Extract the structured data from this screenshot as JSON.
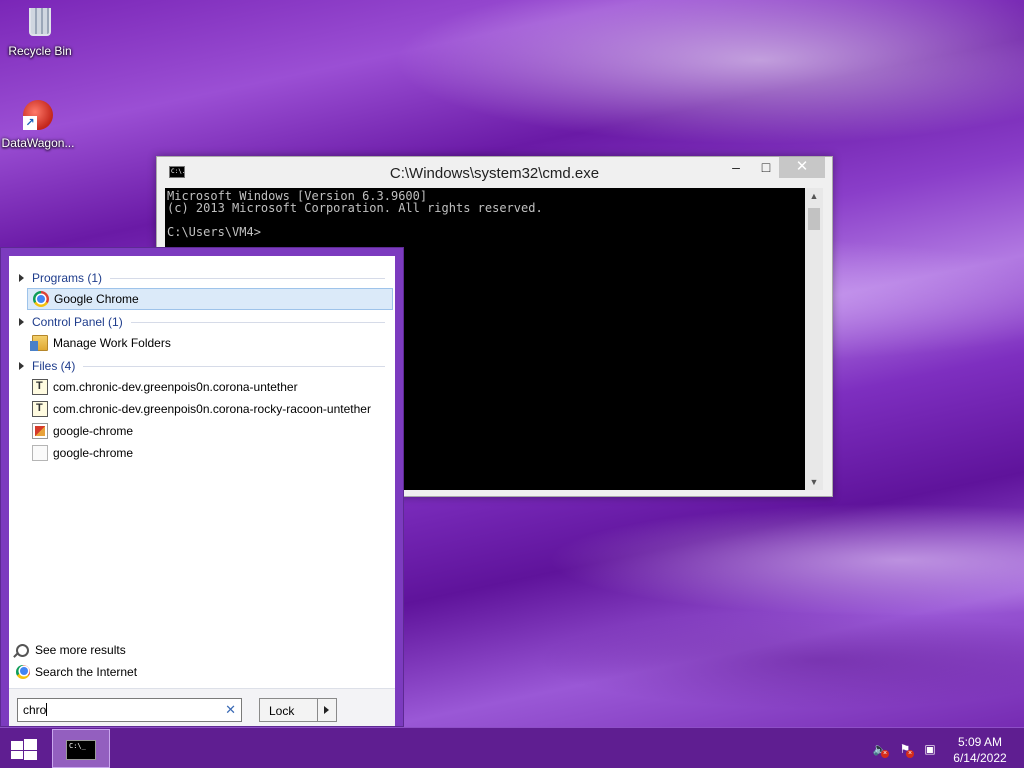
{
  "desktop": {
    "icons": [
      {
        "label": "Recycle Bin",
        "icon": "recycle-bin-icon"
      },
      {
        "label": "DataWagon...",
        "icon": "datawagon-shortcut-icon"
      }
    ]
  },
  "cmd_window": {
    "title": "C:\\Windows\\system32\\cmd.exe",
    "icon_text": "C:\\.",
    "minimize": "–",
    "maximize": "□",
    "close": "✕",
    "console_lines": [
      "Microsoft Windows [Version 6.3.9600]",
      "(c) 2013 Microsoft Corporation. All rights reserved.",
      "",
      "C:\\Users\\VM4>"
    ]
  },
  "start_search": {
    "sections": [
      {
        "header": "Programs (1)",
        "items": [
          {
            "label": "Google Chrome",
            "icon": "chrome-icon",
            "selected": true
          }
        ]
      },
      {
        "header": "Control Panel (1)",
        "items": [
          {
            "label": "Manage Work Folders",
            "icon": "work-folders-icon"
          }
        ]
      },
      {
        "header": "Files (4)",
        "items": [
          {
            "label": "com.chronic-dev.greenpois0n.corona-untether",
            "icon": "text-file-icon"
          },
          {
            "label": "com.chronic-dev.greenpois0n.corona-rocky-racoon-untether",
            "icon": "text-file-icon"
          },
          {
            "label": "google-chrome",
            "icon": "image-file-icon"
          },
          {
            "label": "google-chrome",
            "icon": "blank-file-icon"
          }
        ]
      }
    ],
    "see_more": "See more results",
    "search_internet": "Search the Internet",
    "query": "chro",
    "clear": "✕",
    "lock_label": "Lock"
  },
  "taskbar": {
    "cmd_mini_text": "C:\\_",
    "tray_icons": [
      "volume-muted-icon",
      "action-center-flag-icon",
      "network-icon"
    ],
    "time": "5:09 AM",
    "date": "6/14/2022"
  }
}
